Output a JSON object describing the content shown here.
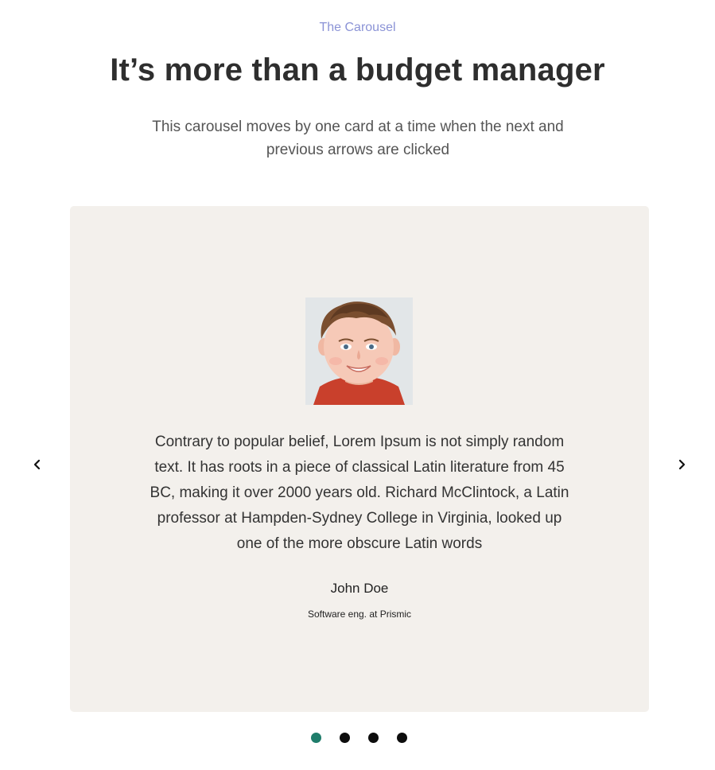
{
  "header": {
    "eyebrow": "The Carousel",
    "title": "It’s more than a budget manager",
    "subtitle": "This carousel moves by one card at a time when the next and previous arrows are clicked"
  },
  "carousel": {
    "prev_icon": "chevron-left-icon",
    "next_icon": "chevron-right-icon",
    "active_index": 0,
    "slide_count": 4,
    "card": {
      "quote": "Contrary to popular belief, Lorem Ipsum is not simply random text. It has roots in a piece of classical Latin literature from 45 BC, making it over 2000 years old. Richard McClintock, a Latin professor at Hampden-Sydney College in Virginia, looked up one of the more obscure Latin words",
      "author_name": "John Doe",
      "author_role": "Software eng. at Prismic"
    }
  },
  "colors": {
    "eyebrow": "#8b93d6",
    "card_background": "#f3f0ec",
    "dot_active": "#1f7d6b",
    "dot_inactive": "#0d0d0d"
  }
}
